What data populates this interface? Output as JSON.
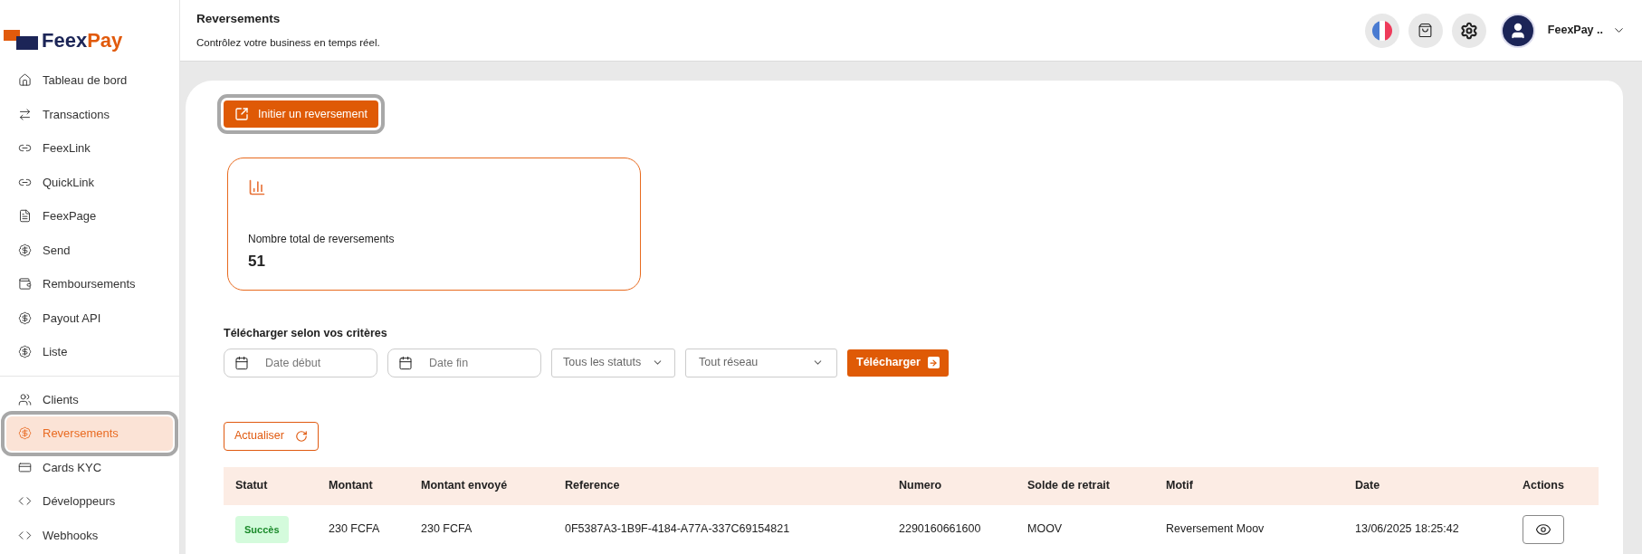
{
  "logo": {
    "text_dark": "Feex",
    "text_accent": "Pay"
  },
  "sidebar": {
    "groups": [
      {
        "items": [
          {
            "label": "Tableau de bord",
            "kind": "home",
            "selected": false
          },
          {
            "label": "Transactions",
            "kind": "arrows",
            "selected": false
          },
          {
            "label": "FeexLink",
            "kind": "link",
            "selected": false
          },
          {
            "label": "QuickLink",
            "kind": "link",
            "selected": false
          },
          {
            "label": "FeexPage",
            "kind": "page",
            "selected": false
          },
          {
            "label": "Send",
            "kind": "money",
            "selected": false
          },
          {
            "label": "Remboursements",
            "kind": "wallet",
            "selected": false
          },
          {
            "label": "Payout API",
            "kind": "money",
            "selected": false
          },
          {
            "label": "Liste",
            "kind": "money",
            "selected": false
          }
        ]
      },
      {
        "items": [
          {
            "label": "Clients",
            "kind": "users",
            "selected": false
          },
          {
            "label": "Reversements",
            "kind": "money",
            "selected": true
          },
          {
            "label": "Cards KYC",
            "kind": "card",
            "selected": false
          },
          {
            "label": "Développeurs",
            "kind": "code",
            "selected": false
          },
          {
            "label": "Webhooks",
            "kind": "code",
            "selected": false
          }
        ]
      }
    ]
  },
  "header": {
    "title": "Reversements",
    "subtitle": "Contrôlez votre business en temps réel.",
    "user": "FeexPay .."
  },
  "primary_button": "Initier un reversement",
  "stat_card": {
    "label": "Nombre total de reversements",
    "value": "51"
  },
  "download": {
    "title": "Télécharger selon vos critères",
    "date_start": {
      "placeholder": "Date début"
    },
    "date_end": {
      "placeholder": "Date fin"
    },
    "status_select": "Tous les statuts",
    "network_select": "Tout réseau",
    "button": "Télécharger"
  },
  "refresh_button": "Actualiser",
  "table": {
    "columns": [
      "Statut",
      "Montant",
      "Montant envoyé",
      "Reference",
      "Numero",
      "Solde de retrait",
      "Motif",
      "Date",
      "Actions"
    ],
    "rows": [
      {
        "status": "Succès",
        "amount": "230 FCFA",
        "sent": "230 FCFA",
        "reference": "0F5387A3-1B9F-4184-A77A-337C69154821",
        "number": "2290160661600",
        "balance": "MOOV",
        "motif": "Reversement Moov",
        "date": "13/06/2025 18:25:42"
      }
    ]
  }
}
